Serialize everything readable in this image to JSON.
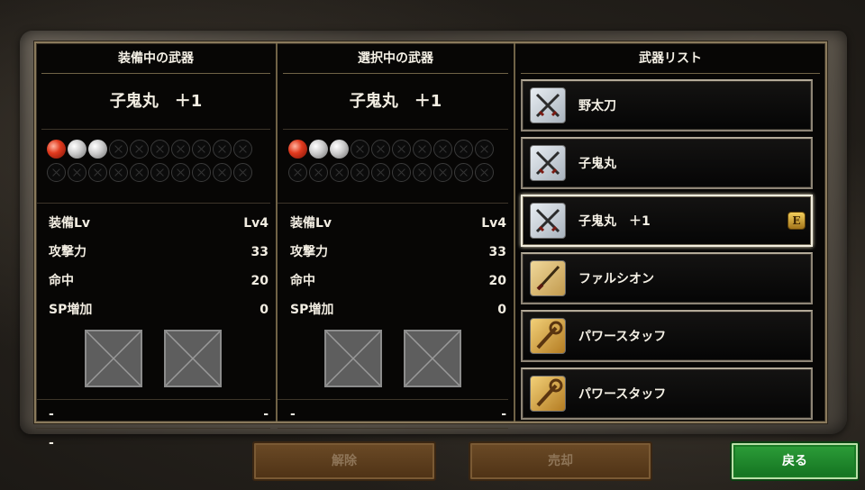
{
  "equipped": {
    "header": "装備中の武器",
    "name": "子鬼丸　＋1",
    "slots_row1": [
      "red",
      "white",
      "white",
      "empty",
      "empty",
      "empty",
      "empty",
      "empty",
      "empty",
      "empty"
    ],
    "slots_row2": [
      "empty",
      "empty",
      "empty",
      "empty",
      "empty",
      "empty",
      "empty",
      "empty",
      "empty",
      "empty"
    ],
    "stats": [
      {
        "label": "装備Lv",
        "value": "Lv4"
      },
      {
        "label": "攻撃力",
        "value": "33"
      },
      {
        "label": "命中",
        "value": "20"
      },
      {
        "label": "SP増加",
        "value": "0"
      }
    ],
    "skills": [
      {
        "left": "-",
        "right": "-"
      },
      {
        "left": "-",
        "right": "-"
      }
    ]
  },
  "selected": {
    "header": "選択中の武器",
    "name": "子鬼丸　＋1",
    "slots_row1": [
      "red",
      "white",
      "white",
      "empty",
      "empty",
      "empty",
      "empty",
      "empty",
      "empty",
      "empty"
    ],
    "slots_row2": [
      "empty",
      "empty",
      "empty",
      "empty",
      "empty",
      "empty",
      "empty",
      "empty",
      "empty",
      "empty"
    ],
    "stats": [
      {
        "label": "装備Lv",
        "value": "Lv4"
      },
      {
        "label": "攻撃力",
        "value": "33"
      },
      {
        "label": "命中",
        "value": "20"
      },
      {
        "label": "SP増加",
        "value": "0"
      }
    ],
    "skills": [
      {
        "left": "-",
        "right": "-"
      },
      {
        "left": "-",
        "right": "-"
      }
    ]
  },
  "weapon_list": {
    "header": "武器リスト",
    "items": [
      {
        "label": "野太刀",
        "icon": "crossed-swords-icon",
        "selected": false,
        "equipped": false
      },
      {
        "label": "子鬼丸",
        "icon": "crossed-swords-icon",
        "selected": false,
        "equipped": false
      },
      {
        "label": "子鬼丸　＋1",
        "icon": "crossed-swords-icon",
        "selected": true,
        "equipped": true
      },
      {
        "label": "ファルシオン",
        "icon": "saber-icon",
        "selected": false,
        "equipped": false
      },
      {
        "label": "パワースタッフ",
        "icon": "staff-icon",
        "selected": false,
        "equipped": false
      },
      {
        "label": "パワースタッフ",
        "icon": "staff-icon",
        "selected": false,
        "equipped": false
      }
    ],
    "equipped_badge": "E"
  },
  "buttons": {
    "unequip": "解除",
    "sell": "売却",
    "back": "戻る"
  },
  "colors": {
    "panel_border": "#8a7a5c",
    "back_button": "#2ea03a",
    "disabled_button": "#6b4a26",
    "selected_border": "#f3eede"
  }
}
